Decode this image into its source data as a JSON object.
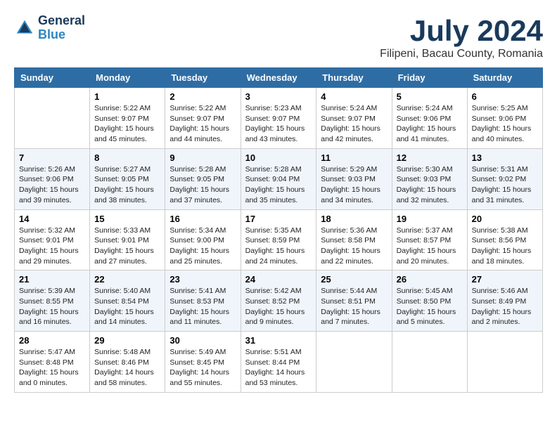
{
  "logo": {
    "line1": "General",
    "line2": "Blue"
  },
  "title": "July 2024",
  "subtitle": "Filipeni, Bacau County, Romania",
  "headers": [
    "Sunday",
    "Monday",
    "Tuesday",
    "Wednesday",
    "Thursday",
    "Friday",
    "Saturday"
  ],
  "weeks": [
    [
      {
        "day": "",
        "sunrise": "",
        "sunset": "",
        "daylight": ""
      },
      {
        "day": "1",
        "sunrise": "Sunrise: 5:22 AM",
        "sunset": "Sunset: 9:07 PM",
        "daylight": "Daylight: 15 hours and 45 minutes."
      },
      {
        "day": "2",
        "sunrise": "Sunrise: 5:22 AM",
        "sunset": "Sunset: 9:07 PM",
        "daylight": "Daylight: 15 hours and 44 minutes."
      },
      {
        "day": "3",
        "sunrise": "Sunrise: 5:23 AM",
        "sunset": "Sunset: 9:07 PM",
        "daylight": "Daylight: 15 hours and 43 minutes."
      },
      {
        "day": "4",
        "sunrise": "Sunrise: 5:24 AM",
        "sunset": "Sunset: 9:07 PM",
        "daylight": "Daylight: 15 hours and 42 minutes."
      },
      {
        "day": "5",
        "sunrise": "Sunrise: 5:24 AM",
        "sunset": "Sunset: 9:06 PM",
        "daylight": "Daylight: 15 hours and 41 minutes."
      },
      {
        "day": "6",
        "sunrise": "Sunrise: 5:25 AM",
        "sunset": "Sunset: 9:06 PM",
        "daylight": "Daylight: 15 hours and 40 minutes."
      }
    ],
    [
      {
        "day": "7",
        "sunrise": "Sunrise: 5:26 AM",
        "sunset": "Sunset: 9:06 PM",
        "daylight": "Daylight: 15 hours and 39 minutes."
      },
      {
        "day": "8",
        "sunrise": "Sunrise: 5:27 AM",
        "sunset": "Sunset: 9:05 PM",
        "daylight": "Daylight: 15 hours and 38 minutes."
      },
      {
        "day": "9",
        "sunrise": "Sunrise: 5:28 AM",
        "sunset": "Sunset: 9:05 PM",
        "daylight": "Daylight: 15 hours and 37 minutes."
      },
      {
        "day": "10",
        "sunrise": "Sunrise: 5:28 AM",
        "sunset": "Sunset: 9:04 PM",
        "daylight": "Daylight: 15 hours and 35 minutes."
      },
      {
        "day": "11",
        "sunrise": "Sunrise: 5:29 AM",
        "sunset": "Sunset: 9:03 PM",
        "daylight": "Daylight: 15 hours and 34 minutes."
      },
      {
        "day": "12",
        "sunrise": "Sunrise: 5:30 AM",
        "sunset": "Sunset: 9:03 PM",
        "daylight": "Daylight: 15 hours and 32 minutes."
      },
      {
        "day": "13",
        "sunrise": "Sunrise: 5:31 AM",
        "sunset": "Sunset: 9:02 PM",
        "daylight": "Daylight: 15 hours and 31 minutes."
      }
    ],
    [
      {
        "day": "14",
        "sunrise": "Sunrise: 5:32 AM",
        "sunset": "Sunset: 9:01 PM",
        "daylight": "Daylight: 15 hours and 29 minutes."
      },
      {
        "day": "15",
        "sunrise": "Sunrise: 5:33 AM",
        "sunset": "Sunset: 9:01 PM",
        "daylight": "Daylight: 15 hours and 27 minutes."
      },
      {
        "day": "16",
        "sunrise": "Sunrise: 5:34 AM",
        "sunset": "Sunset: 9:00 PM",
        "daylight": "Daylight: 15 hours and 25 minutes."
      },
      {
        "day": "17",
        "sunrise": "Sunrise: 5:35 AM",
        "sunset": "Sunset: 8:59 PM",
        "daylight": "Daylight: 15 hours and 24 minutes."
      },
      {
        "day": "18",
        "sunrise": "Sunrise: 5:36 AM",
        "sunset": "Sunset: 8:58 PM",
        "daylight": "Daylight: 15 hours and 22 minutes."
      },
      {
        "day": "19",
        "sunrise": "Sunrise: 5:37 AM",
        "sunset": "Sunset: 8:57 PM",
        "daylight": "Daylight: 15 hours and 20 minutes."
      },
      {
        "day": "20",
        "sunrise": "Sunrise: 5:38 AM",
        "sunset": "Sunset: 8:56 PM",
        "daylight": "Daylight: 15 hours and 18 minutes."
      }
    ],
    [
      {
        "day": "21",
        "sunrise": "Sunrise: 5:39 AM",
        "sunset": "Sunset: 8:55 PM",
        "daylight": "Daylight: 15 hours and 16 minutes."
      },
      {
        "day": "22",
        "sunrise": "Sunrise: 5:40 AM",
        "sunset": "Sunset: 8:54 PM",
        "daylight": "Daylight: 15 hours and 14 minutes."
      },
      {
        "day": "23",
        "sunrise": "Sunrise: 5:41 AM",
        "sunset": "Sunset: 8:53 PM",
        "daylight": "Daylight: 15 hours and 11 minutes."
      },
      {
        "day": "24",
        "sunrise": "Sunrise: 5:42 AM",
        "sunset": "Sunset: 8:52 PM",
        "daylight": "Daylight: 15 hours and 9 minutes."
      },
      {
        "day": "25",
        "sunrise": "Sunrise: 5:44 AM",
        "sunset": "Sunset: 8:51 PM",
        "daylight": "Daylight: 15 hours and 7 minutes."
      },
      {
        "day": "26",
        "sunrise": "Sunrise: 5:45 AM",
        "sunset": "Sunset: 8:50 PM",
        "daylight": "Daylight: 15 hours and 5 minutes."
      },
      {
        "day": "27",
        "sunrise": "Sunrise: 5:46 AM",
        "sunset": "Sunset: 8:49 PM",
        "daylight": "Daylight: 15 hours and 2 minutes."
      }
    ],
    [
      {
        "day": "28",
        "sunrise": "Sunrise: 5:47 AM",
        "sunset": "Sunset: 8:48 PM",
        "daylight": "Daylight: 15 hours and 0 minutes."
      },
      {
        "day": "29",
        "sunrise": "Sunrise: 5:48 AM",
        "sunset": "Sunset: 8:46 PM",
        "daylight": "Daylight: 14 hours and 58 minutes."
      },
      {
        "day": "30",
        "sunrise": "Sunrise: 5:49 AM",
        "sunset": "Sunset: 8:45 PM",
        "daylight": "Daylight: 14 hours and 55 minutes."
      },
      {
        "day": "31",
        "sunrise": "Sunrise: 5:51 AM",
        "sunset": "Sunset: 8:44 PM",
        "daylight": "Daylight: 14 hours and 53 minutes."
      },
      {
        "day": "",
        "sunrise": "",
        "sunset": "",
        "daylight": ""
      },
      {
        "day": "",
        "sunrise": "",
        "sunset": "",
        "daylight": ""
      },
      {
        "day": "",
        "sunrise": "",
        "sunset": "",
        "daylight": ""
      }
    ]
  ]
}
